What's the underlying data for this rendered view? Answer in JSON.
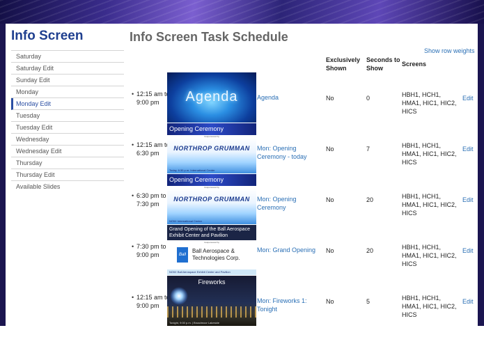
{
  "app": {
    "title": "Info Screen"
  },
  "sidebar": {
    "items": [
      {
        "label": "Saturday"
      },
      {
        "label": "Saturday Edit"
      },
      {
        "label": "Sunday Edit"
      },
      {
        "label": "Monday"
      },
      {
        "label": "Monday Edit"
      },
      {
        "label": "Tuesday"
      },
      {
        "label": "Tuesday Edit"
      },
      {
        "label": "Wednesday"
      },
      {
        "label": "Wednesday Edit"
      },
      {
        "label": "Thursday"
      },
      {
        "label": "Thursday Edit"
      },
      {
        "label": "Available Slides"
      }
    ],
    "active_item": "Monday Edit"
  },
  "main": {
    "title": "Info Screen Task Schedule",
    "row_weights_link": "Show row weights",
    "columns": {
      "exclusively_shown": "Exclusively Shown",
      "seconds_to_show": "Seconds to Show",
      "screens": "Screens"
    },
    "rows": [
      {
        "bullet": "•",
        "time": "12:15 am to 9:00 pm",
        "thumb_text": "Agenda",
        "slide": "Agenda",
        "exclusive": "No",
        "seconds": "0",
        "screens": "HBH1, HCH1, HMA1, HIC1, HIC2, HICS",
        "edit": "Edit"
      },
      {
        "bullet": "•",
        "time": "12:15 am to 6:30 pm",
        "thumb_head": "Opening Ceremony",
        "thumb_sub": "Cosponsored by",
        "thumb_logo": "NORTHROP GRUMMAN",
        "thumb_foot": "Today, 6:30 p.m. International Center",
        "slide": "Mon: Opening Ceremony - today",
        "exclusive": "No",
        "seconds": "7",
        "screens": "HBH1, HCH1, HMA1, HIC1, HIC2, HICS",
        "edit": "Edit"
      },
      {
        "bullet": "•",
        "time": "6:30 pm to 7:30 pm",
        "thumb_head": "Opening Ceremony",
        "thumb_sub": "Cosponsored by",
        "thumb_logo": "NORTHROP GRUMMAN",
        "thumb_foot": "NOW: International Center",
        "slide": "Mon: Opening Ceremony",
        "exclusive": "No",
        "seconds": "20",
        "screens": "HBH1, HCH1, HMA1, HIC1, HIC2, HICS",
        "edit": "Edit"
      },
      {
        "bullet": "•",
        "time": "7:30 pm to 9:00 pm",
        "thumb_head": "Grand Opening of the Ball Aerospace Exhibit Center and Pavilion",
        "thumb_sub": "Cosponsored by",
        "thumb_logo_mark": "Ball",
        "thumb_logo": "Ball Aerospace & Technologies Corp.",
        "thumb_foot": "NOW: Ball Aerospace Exhibit Center and Pavilion",
        "slide": "Mon: Grand Opening",
        "exclusive": "No",
        "seconds": "20",
        "screens": "HBH1, HCH1, HMA1, HIC1, HIC2, HICS",
        "edit": "Edit"
      },
      {
        "bullet": "•",
        "time": "12:15 am to 9:00 pm",
        "thumb_head": "Fireworks",
        "thumb_foot": "Tonight, 9:00 p.m. | Broadmoor Lakeside",
        "slide": "Mon: Fireworks 1: Tonight",
        "exclusive": "No",
        "seconds": "5",
        "screens": "HBH1, HCH1, HMA1, HIC1, HIC2, HICS",
        "edit": "Edit"
      }
    ]
  }
}
